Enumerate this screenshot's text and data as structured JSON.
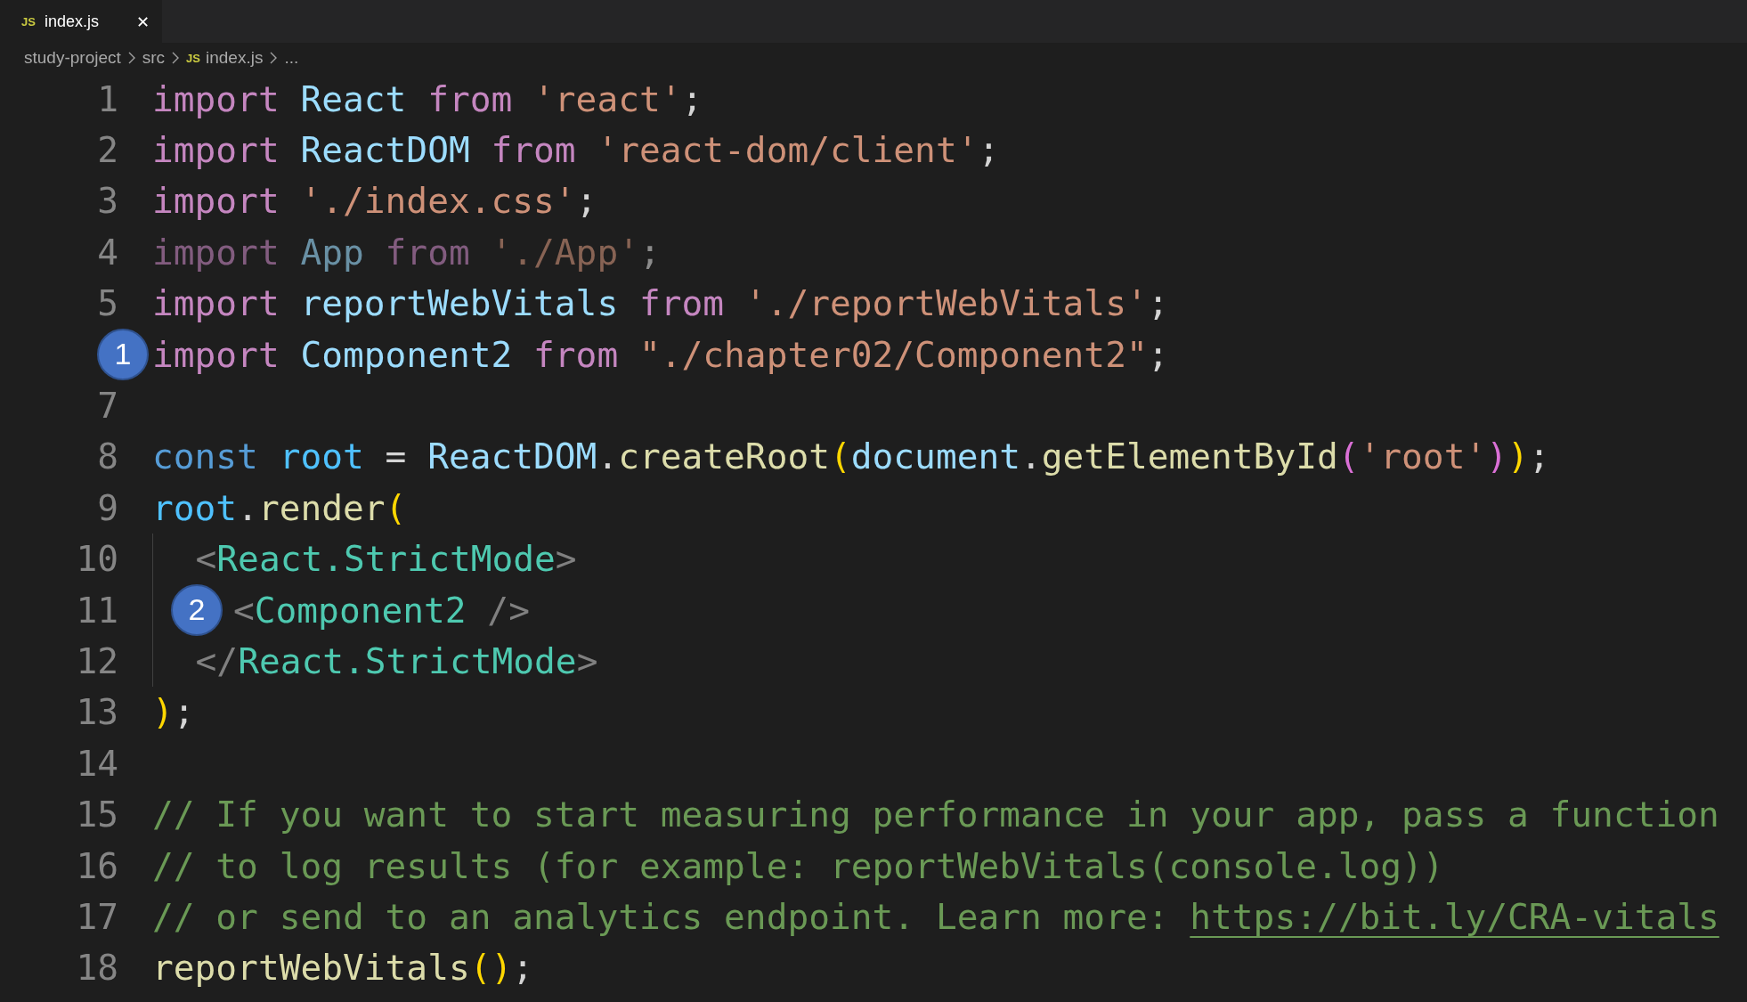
{
  "tab": {
    "icon_label": "JS",
    "title": "index.js",
    "close": "✕",
    "selected": true
  },
  "breadcrumb": [
    {
      "text": "study-project",
      "kind": "folder"
    },
    {
      "text": "src",
      "kind": "folder"
    },
    {
      "text": "index.js",
      "kind": "file",
      "icon_label": "JS"
    },
    {
      "text": "...",
      "kind": "more"
    }
  ],
  "lines": [
    {
      "number": "1",
      "tokens": [
        {
          "text": "import",
          "kind": "keyword"
        },
        {
          "text": " React",
          "kind": "variable"
        },
        {
          "text": " from",
          "kind": "keyword"
        },
        {
          "text": " 'react'",
          "kind": "string"
        },
        {
          "text": ";",
          "kind": "punct"
        }
      ]
    },
    {
      "number": "2",
      "tokens": [
        {
          "text": "import",
          "kind": "keyword"
        },
        {
          "text": " ReactDOM",
          "kind": "variable"
        },
        {
          "text": " from",
          "kind": "keyword"
        },
        {
          "text": " 'react-dom/client'",
          "kind": "string"
        },
        {
          "text": ";",
          "kind": "punct"
        }
      ]
    },
    {
      "number": "3",
      "tokens": [
        {
          "text": "import",
          "kind": "keyword"
        },
        {
          "text": " './index.css'",
          "kind": "string"
        },
        {
          "text": ";",
          "kind": "punct"
        }
      ]
    },
    {
      "number": "4",
      "dimmed": true,
      "tokens": [
        {
          "text": "import",
          "kind": "keyword"
        },
        {
          "text": " App",
          "kind": "variable"
        },
        {
          "text": " from",
          "kind": "keyword"
        },
        {
          "text": " './App'",
          "kind": "string"
        },
        {
          "text": ";",
          "kind": "punct"
        }
      ]
    },
    {
      "number": "5",
      "tokens": [
        {
          "text": "import",
          "kind": "keyword"
        },
        {
          "text": " reportWebVitals",
          "kind": "variable"
        },
        {
          "text": " from",
          "kind": "keyword"
        },
        {
          "text": " './reportWebVitals'",
          "kind": "string"
        },
        {
          "text": ";",
          "kind": "punct"
        }
      ]
    },
    {
      "gutter_badge": "1",
      "tokens": [
        {
          "text": "import",
          "kind": "keyword"
        },
        {
          "text": " Component2",
          "kind": "variable"
        },
        {
          "text": " from",
          "kind": "keyword"
        },
        {
          "text": " \"./chapter02/Component2\"",
          "kind": "string"
        },
        {
          "text": ";",
          "kind": "punct"
        }
      ]
    },
    {
      "number": "7"
    },
    {
      "number": "8",
      "tokens": [
        {
          "text": "const",
          "kind": "storage"
        },
        {
          "text": " root",
          "kind": "constant"
        },
        {
          "text": " =",
          "kind": "punct"
        },
        {
          "text": " ReactDOM",
          "kind": "variable"
        },
        {
          "text": ".",
          "kind": "punct"
        },
        {
          "text": "createRoot",
          "kind": "function"
        },
        {
          "text": "(",
          "kind": "bracket1"
        },
        {
          "text": "document",
          "kind": "variable"
        },
        {
          "text": ".",
          "kind": "punct"
        },
        {
          "text": "getElementById",
          "kind": "function"
        },
        {
          "text": "(",
          "kind": "bracket2"
        },
        {
          "text": "'root'",
          "kind": "string"
        },
        {
          "text": ")",
          "kind": "bracket2"
        },
        {
          "text": ")",
          "kind": "bracket1"
        },
        {
          "text": ";",
          "kind": "punct"
        }
      ]
    },
    {
      "number": "9",
      "tokens": [
        {
          "text": "root",
          "kind": "constant"
        },
        {
          "text": ".",
          "kind": "punct"
        },
        {
          "text": "render",
          "kind": "function"
        },
        {
          "text": "(",
          "kind": "bracket1"
        }
      ]
    },
    {
      "number": "10",
      "guide": true,
      "tokens": [
        {
          "text": "  <",
          "kind": "angle"
        },
        {
          "text": "React.StrictMode",
          "kind": "tag"
        },
        {
          "text": ">",
          "kind": "angle"
        }
      ]
    },
    {
      "number": "11",
      "guide": true,
      "tokens": [
        {
          "text": "2",
          "kind": "badge"
        },
        {
          "text": "<",
          "kind": "angle"
        },
        {
          "text": "Component2",
          "kind": "tag"
        },
        {
          "text": " />",
          "kind": "angle"
        }
      ]
    },
    {
      "number": "12",
      "guide": true,
      "tokens": [
        {
          "text": "  </",
          "kind": "angle"
        },
        {
          "text": "React.StrictMode",
          "kind": "tag"
        },
        {
          "text": ">",
          "kind": "angle"
        }
      ]
    },
    {
      "number": "13",
      "tokens": [
        {
          "text": ")",
          "kind": "bracket1"
        },
        {
          "text": ";",
          "kind": "punct"
        }
      ]
    },
    {
      "number": "14"
    },
    {
      "number": "15",
      "tokens": [
        {
          "text": "// If you want to start measuring performance in your app, pass a function",
          "kind": "comment"
        }
      ]
    },
    {
      "number": "16",
      "tokens": [
        {
          "text": "// to log results (for example: reportWebVitals(console.log))",
          "kind": "comment"
        }
      ]
    },
    {
      "number": "17",
      "tokens": [
        {
          "text": "// or send to an analytics endpoint. Learn more: ",
          "kind": "comment"
        },
        {
          "text": "https://bit.ly/CRA-vitals",
          "kind": "link"
        }
      ]
    },
    {
      "number": "18",
      "tokens": [
        {
          "text": "reportWebVitals",
          "kind": "function"
        },
        {
          "text": "(",
          "kind": "bracket1"
        },
        {
          "text": ")",
          "kind": "bracket1"
        },
        {
          "text": ";",
          "kind": "punct"
        }
      ]
    }
  ]
}
